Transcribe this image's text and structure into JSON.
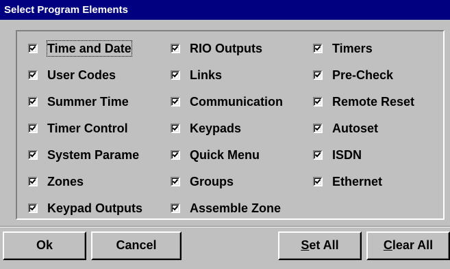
{
  "window": {
    "title": "Select Program Elements"
  },
  "columns": [
    [
      {
        "label": "Time and Date",
        "checked": true
      },
      {
        "label": "User Codes",
        "checked": true
      },
      {
        "label": "Summer Time",
        "checked": true
      },
      {
        "label": "Timer Control",
        "checked": true
      },
      {
        "label": "System Parame",
        "checked": true
      },
      {
        "label": "Zones",
        "checked": true
      },
      {
        "label": "Keypad Outputs",
        "checked": true
      }
    ],
    [
      {
        "label": "RIO Outputs",
        "checked": true
      },
      {
        "label": "Links",
        "checked": true
      },
      {
        "label": "Communication",
        "checked": true
      },
      {
        "label": "Keypads",
        "checked": true
      },
      {
        "label": "Quick Menu",
        "checked": true
      },
      {
        "label": "Groups",
        "checked": true
      },
      {
        "label": "Assemble Zone",
        "checked": true
      }
    ],
    [
      {
        "label": "Timers",
        "checked": true
      },
      {
        "label": "Pre-Check",
        "checked": true
      },
      {
        "label": "Remote Reset",
        "checked": true
      },
      {
        "label": "Autoset",
        "checked": true
      },
      {
        "label": "ISDN",
        "checked": true
      },
      {
        "label": "Ethernet",
        "checked": true
      }
    ]
  ],
  "buttons": {
    "ok": "Ok",
    "cancel": "Cancel",
    "set_all": {
      "mnemonic": "S",
      "rest": "et All"
    },
    "clear_all": {
      "mnemonic": "C",
      "rest": "lear All"
    }
  },
  "colors": {
    "titlebar": "#000080",
    "face": "#c0c0c0"
  }
}
